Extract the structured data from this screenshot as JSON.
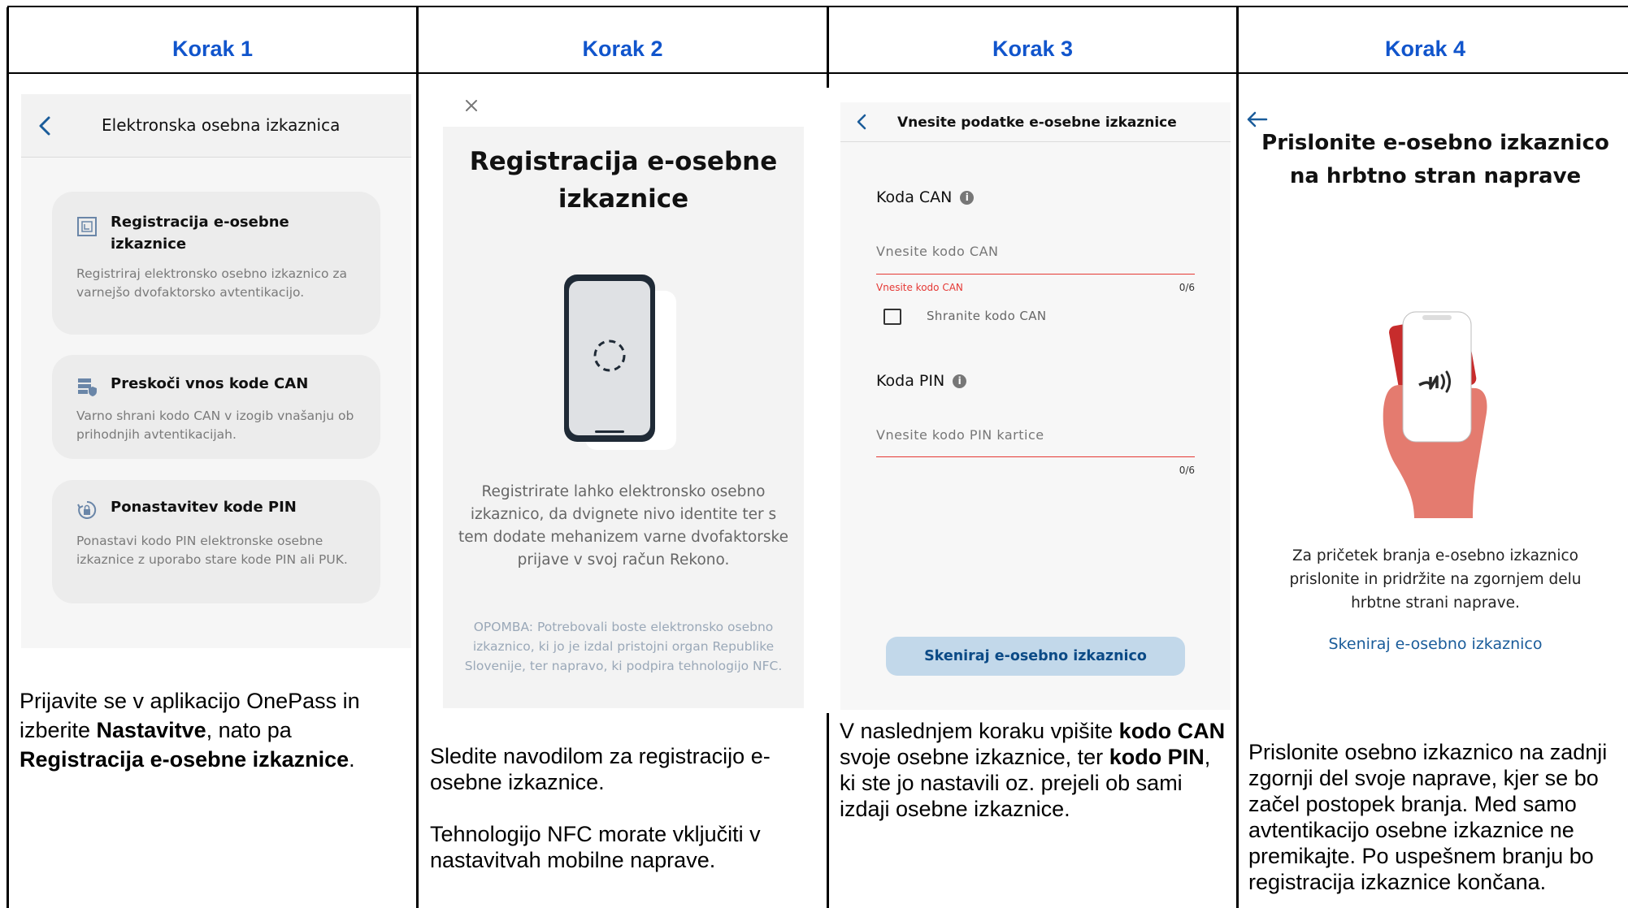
{
  "steps": [
    {
      "heading": "Korak 1",
      "screen": {
        "title": "Elektronska osebna izkaznica",
        "cards": [
          {
            "title": "Registracija e-osebne izkaznice",
            "desc": "Registriraj elektronsko osebno izkaznico za varnejšo dvofaktorsko avtentikacijo.",
            "icon": "id-card-icon"
          },
          {
            "title": "Preskoči vnos kode CAN",
            "desc": "Varno shrani kodo CAN v izogib vnašanju ob prihodnjih avtentikacijah.",
            "icon": "shield-database-icon"
          },
          {
            "title": "Ponastavitev kode PIN",
            "desc": "Ponastavi kodo PIN elektronske osebne izkaznice z uporabo stare kode PIN ali PUK.",
            "icon": "lock-reset-icon"
          }
        ]
      },
      "caption": {
        "a": "Prijavite se v aplikacijo OnePass in izberite ",
        "b": "Nastavitve",
        "c": ", nato pa ",
        "d": "Registracija e-osebne izkaznice",
        "e": "."
      }
    },
    {
      "heading": "Korak 2",
      "screen": {
        "title": "Registracija e-osebne izkaznice",
        "desc": "Registrirate lahko elektronsko osebno izkaznico, da dvignete nivo identite ter s tem dodate mehanizem varne dvofaktorske prijave v svoj račun Rekono.",
        "note": "OPOMBA: Potrebovali boste elektronsko osebno izkaznico, ki jo je izdal pristojni organ Republike Slovenije, ter napravo, ki podpira tehnologijo NFC."
      },
      "caption": {
        "p1": "Sledite navodilom za registracijo e-osebne izkaznice.",
        "p2": "Tehnologijo NFC morate vključiti v nastavitvah mobilne naprave."
      }
    },
    {
      "heading": "Korak 3",
      "screen": {
        "title": "Vnesite podatke e-osebne izkaznice",
        "can_label": "Koda CAN",
        "can_placeholder": "Vnesite kodo CAN",
        "can_error": "Vnesite kodo CAN",
        "can_counter": "0/6",
        "save_can": "Shranite kodo CAN",
        "pin_label": "Koda PIN",
        "pin_placeholder": "Vnesite kodo PIN kartice",
        "pin_counter": "0/6",
        "scan_button": "Skeniraj e-osebno izkaznico"
      },
      "caption": {
        "a": "V naslednjem koraku vpišite ",
        "b": "kodo CAN",
        "c": " svoje osebne izkaznice, ter ",
        "d": "kodo PIN",
        "e": ", ki ste jo nastavili oz. prejeli ob sami izdaji osebne izkaznice."
      }
    },
    {
      "heading": "Korak 4",
      "screen": {
        "title": "Prislonite e-osebno izkaznico na hrbtno stran naprave",
        "desc": "Za pričetek branja e-osebno izkaznico prislonite in pridržite na zgornjem delu hrbtne strani naprave.",
        "link": "Skeniraj e-osebno izkaznico"
      },
      "caption": {
        "p": "Prislonite osebno izkaznico na zadnji zgornji del svoje naprave, kjer se bo začel postopek branja. Med samo avtentikacijo osebne izkaznice ne premikajte. Po uspešnem branju bo registracija izkaznice končana."
      }
    }
  ],
  "colors": {
    "heading": "#1155cc",
    "link": "#1a5c9a",
    "error": "#e53935",
    "button_bg": "#c2d8ea",
    "card_bg": "#ececec"
  }
}
